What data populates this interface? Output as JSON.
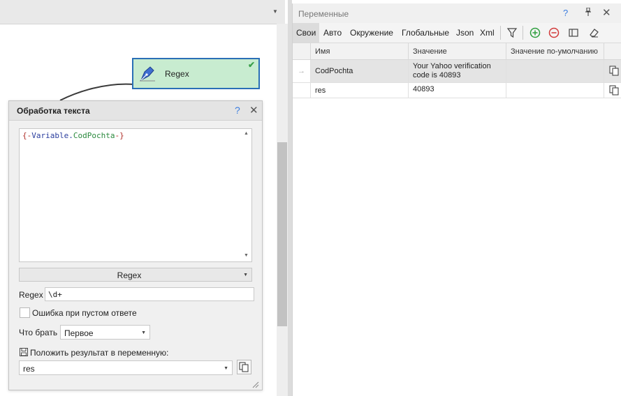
{
  "node": {
    "title": "Regex"
  },
  "editor_panel": {
    "title": "Обработка текста",
    "help": "?",
    "close": "✕",
    "editor_tokens": {
      "open": "{-",
      "var": "Variable",
      "dot": ".",
      "name": "CodPochta",
      "close": "-}"
    },
    "mode_value": "Regex",
    "regex_label": "Regex",
    "regex_value": "\\d+",
    "empty_error_label": "Ошибка при пустом ответе",
    "take_label": "Что брать",
    "take_value": "Первое",
    "save_label": "Положить результат в переменную:",
    "save_variable": "res"
  },
  "variables_panel": {
    "title": "Переменные",
    "help": "?",
    "pin": "🖈",
    "close": "✕",
    "tabs": [
      {
        "label": "Свои",
        "active": true
      },
      {
        "label": "Авто"
      },
      {
        "label": "Окружение"
      },
      {
        "label": "Глобальные"
      },
      {
        "label": "Json"
      },
      {
        "label": "Xml"
      }
    ],
    "columns": [
      "Имя",
      "Значение",
      "Значение по-умолчанию"
    ],
    "rows": [
      {
        "name": "CodPochta",
        "value_line1": "Your Yahoo verification",
        "value_line2": "code is 40893",
        "default": ""
      },
      {
        "name": "res",
        "value_line1": "40893",
        "value_line2": "",
        "default": ""
      }
    ]
  },
  "colors": {
    "accent": "#2a6fb6",
    "node_fill": "#c8ecd0",
    "add": "#2e9e3e",
    "remove": "#d23a3a"
  }
}
